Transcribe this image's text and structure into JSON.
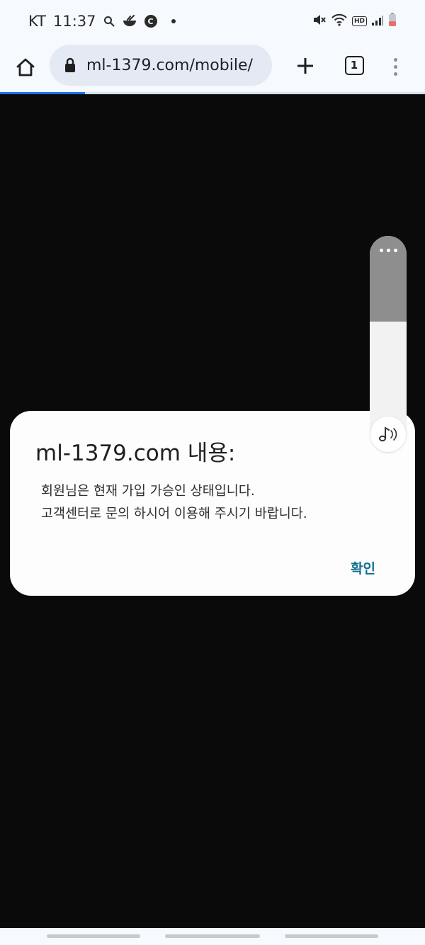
{
  "status_bar": {
    "carrier": "KT",
    "time": "11:37",
    "c_badge": "C",
    "hd_label": "HD"
  },
  "toolbar": {
    "url": "ml-1379.com/mobile/",
    "tab_count": "1"
  },
  "page_load_progress": 0.2,
  "dialog": {
    "title": "ml-1379.com 내용:",
    "message_lines": [
      "회원님은 현재 가입 가승인 상태입니다.",
      "고객센터로 문의 하시어 이용해 주시기 바랍니다."
    ],
    "confirm_label": "확인"
  },
  "volume_panel": {
    "level": 0.6
  },
  "colors": {
    "accent_button": "#12708e",
    "progress": "#1a73e8",
    "page_background": "#0a0a0a"
  }
}
